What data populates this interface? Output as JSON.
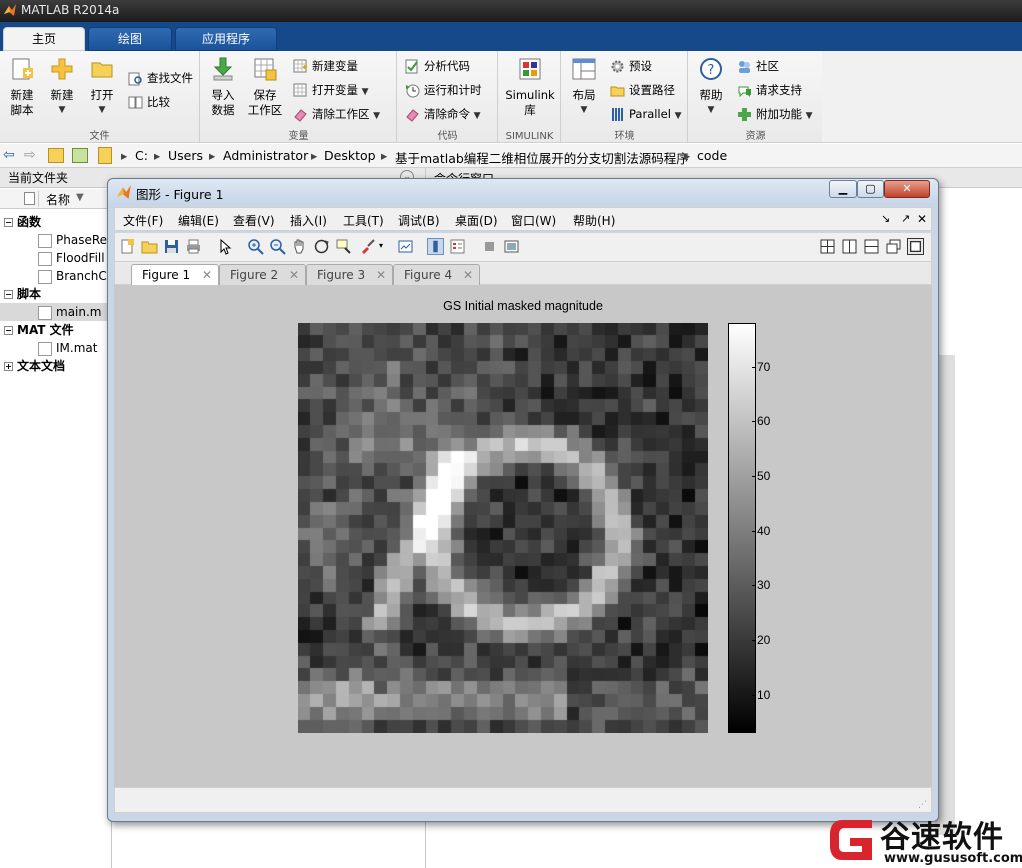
{
  "app": {
    "title": "MATLAB R2014a"
  },
  "ribbon_tabs": [
    {
      "label": "主页"
    },
    {
      "label": "绘图"
    },
    {
      "label": "应用程序"
    }
  ],
  "ribbon": {
    "file": {
      "label": "文件",
      "new_script": [
        "新建",
        "脚本"
      ],
      "new": "新建",
      "open": "打开",
      "find_files": "查找文件",
      "compare": "比较"
    },
    "variable": {
      "label": "变量",
      "import": [
        "导入",
        "数据"
      ],
      "save": [
        "保存",
        "工作区"
      ],
      "new_var": "新建变量",
      "open_var": "打开变量",
      "clear_ws": "清除工作区"
    },
    "code": {
      "label": "代码",
      "analyze": "分析代码",
      "run_time": "运行和计时",
      "clear_cmd": "清除命令"
    },
    "simulink": {
      "label": "SIMULINK",
      "lib": [
        "Simulink",
        "库"
      ]
    },
    "env": {
      "label": "环境",
      "layout": "布局",
      "prefs": "预设",
      "path": "设置路径",
      "parallel": "Parallel"
    },
    "resources": {
      "label": "资源",
      "help": "帮助",
      "community": "社区",
      "support": "请求支持",
      "addons": "附加功能"
    }
  },
  "address": {
    "crumbs": [
      "C:",
      "Users",
      "Administrator",
      "Desktop",
      "基于matlab编程二维相位展开的分支切割法源码程序",
      "code"
    ]
  },
  "current_folder": {
    "title": "当前文件夹",
    "col_name": "名称",
    "groups": [
      {
        "label": "函数",
        "items": [
          "PhaseRe",
          "FloodFill",
          "BranchC"
        ]
      },
      {
        "label": "脚本",
        "items": [
          "main.m"
        ]
      },
      {
        "label": "MAT 文件",
        "items": [
          "IM.mat"
        ]
      },
      {
        "label": "文本文档",
        "items": []
      }
    ]
  },
  "right_panel": {
    "title": "命令行窗口"
  },
  "figure": {
    "title": "图形 - Figure 1",
    "menu": [
      "文件(F)",
      "编辑(E)",
      "查看(V)",
      "插入(I)",
      "工具(T)",
      "调试(B)",
      "桌面(D)",
      "窗口(W)",
      "帮助(H)"
    ],
    "tabs": [
      "Figure 1",
      "Figure 2",
      "Figure 3",
      "Figure 4"
    ],
    "active_tab": "Figure 1"
  },
  "chart_data": {
    "type": "heatmap",
    "title": "GS Initial masked magnitude",
    "colormap": "gray",
    "colorbar_ticks": [
      10,
      20,
      30,
      40,
      50,
      60,
      70
    ],
    "clim": [
      3,
      78
    ],
    "grid_size": [
      32,
      32
    ]
  },
  "watermark": {
    "brand": "谷速软件",
    "url": "www.gususoft.com"
  },
  "colors": {
    "title_bar": "#1c1c1c",
    "tab_row": "#15498a",
    "ribbon": "#eeeeee",
    "figure_frame": "#c9d6e6",
    "axes_bg": "#c8c8c8"
  }
}
